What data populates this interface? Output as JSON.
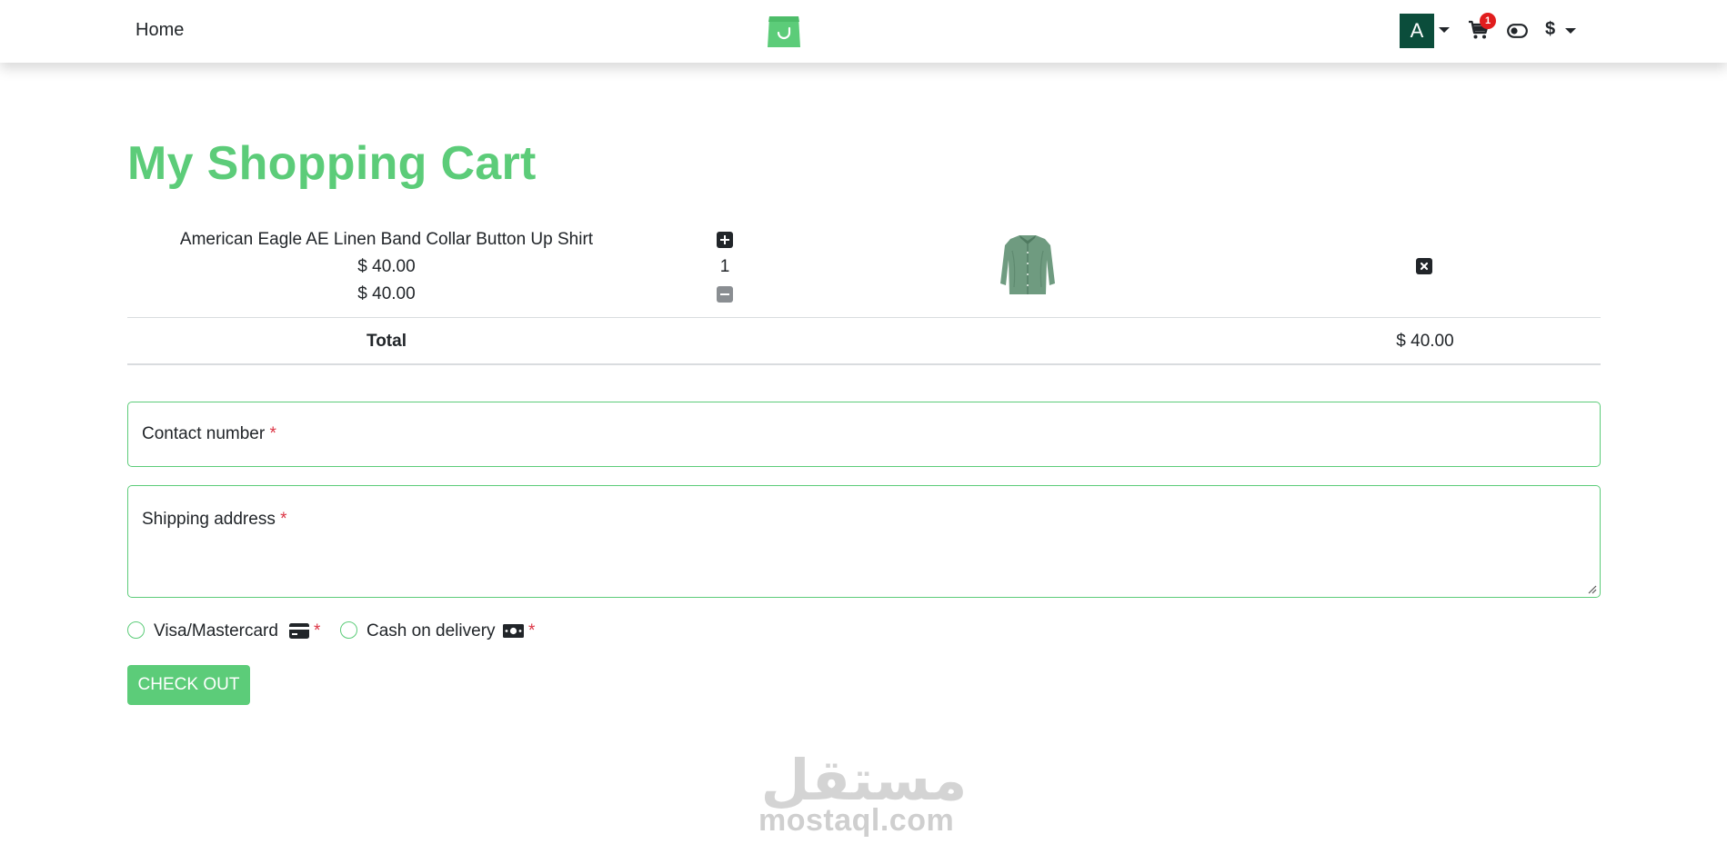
{
  "nav": {
    "home_label": "Home",
    "avatar_letter": "A",
    "cart_count": "1",
    "currency_symbol": "$"
  },
  "page": {
    "title": "My Shopping Cart"
  },
  "cart": {
    "items": [
      {
        "name": "American Eagle AE Linen Band Collar Button Up Shirt",
        "unit_price": "$ 40.00",
        "line_total": "$ 40.00",
        "quantity": "1",
        "image_icon": "shirt-image"
      }
    ],
    "total_label": "Total",
    "total_value": "$ 40.00"
  },
  "form": {
    "contact_label": "Contact number",
    "shipping_label": "Shipping address",
    "required_mark": "*",
    "payment_options": [
      {
        "label": "Visa/Mastercard",
        "icon": "credit-card-icon"
      },
      {
        "label": "Cash on delivery",
        "icon": "money-bill-icon"
      }
    ],
    "checkout_label": "CHECK OUT"
  },
  "watermark": {
    "text": "mostaql.com",
    "arabic": "مستقل"
  },
  "colors": {
    "accent": "#5ccc79",
    "avatar_bg": "#0b4d3b",
    "badge": "#e11d1d",
    "required": "#dc3545"
  }
}
